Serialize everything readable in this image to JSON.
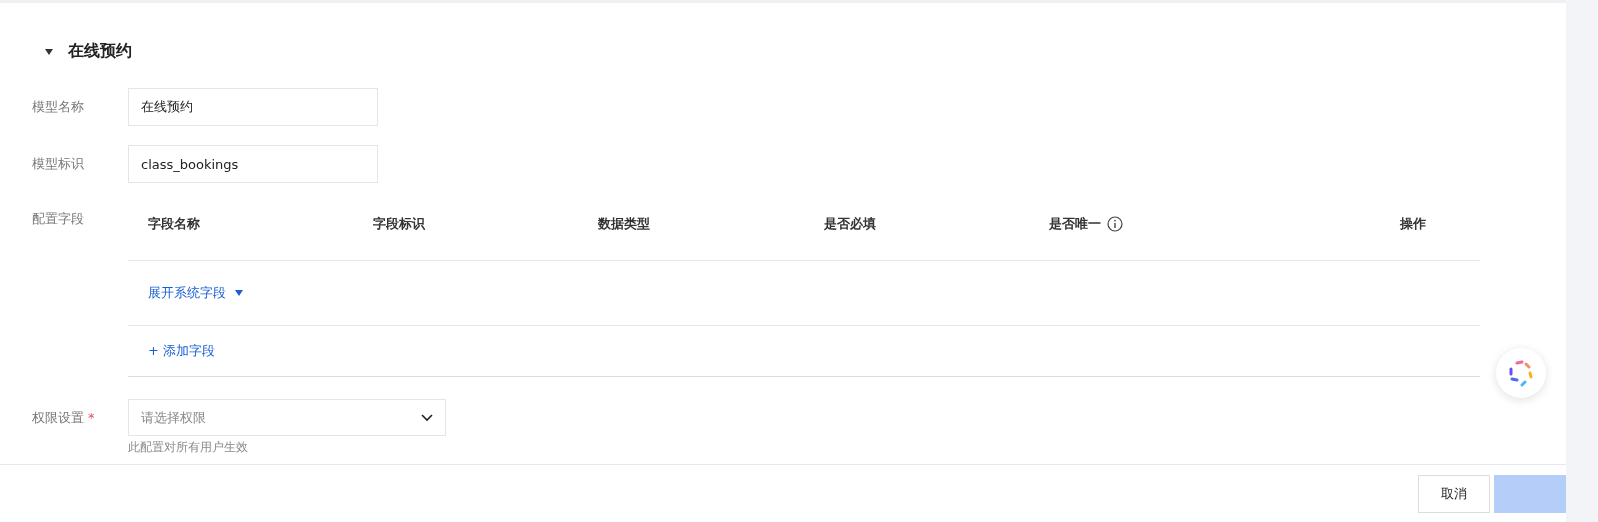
{
  "section": {
    "title": "在线预约",
    "expanded": true
  },
  "fields": [
    {
      "label": "模型名称",
      "value": "在线预约"
    },
    {
      "label": "模型标识",
      "value": "class_bookings"
    }
  ],
  "config": {
    "label": "配置字段",
    "columns": [
      {
        "label": "字段名称",
        "info": false
      },
      {
        "label": "字段标识",
        "info": false
      },
      {
        "label": "数据类型",
        "info": false
      },
      {
        "label": "是否必填",
        "info": false
      },
      {
        "label": "是否唯一",
        "info": true
      },
      {
        "label": "操作",
        "info": false
      }
    ],
    "expand_link": "展开系统字段",
    "add_link": "+ 添加字段"
  },
  "permission": {
    "label": "权限设置",
    "required": true,
    "required_mark": "*",
    "placeholder": "请选择权限",
    "hint": "此配置对所有用户生效"
  },
  "footer": {
    "cancel": "取消"
  }
}
